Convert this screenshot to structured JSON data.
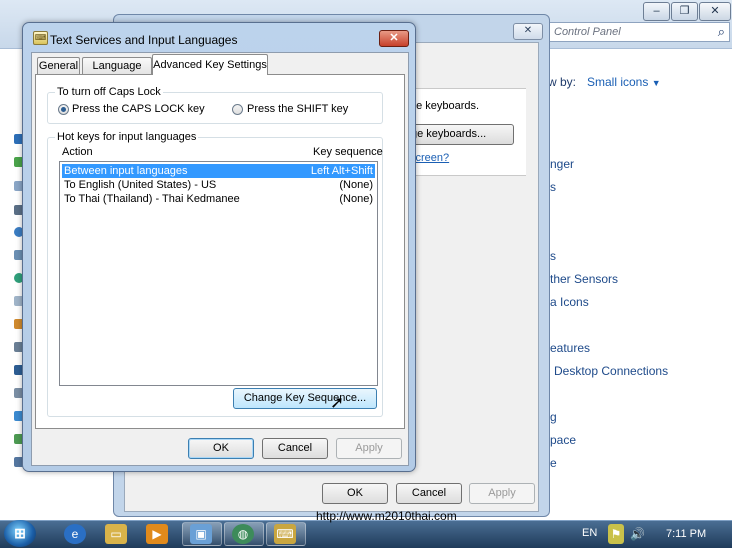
{
  "control_panel": {
    "search_placeholder": "Control Panel",
    "view_by_label": "w by:",
    "view_by_value": "Small icons",
    "items": [
      "nger",
      "s",
      "s",
      "ther Sensors",
      "a Icons",
      "eatures",
      "Desktop Connections",
      "g",
      "pace",
      "e"
    ],
    "window_buttons": [
      "–",
      "❐",
      "✕"
    ]
  },
  "region_dialog": {
    "close": "✕",
    "keyboards_text": "ge keyboards.",
    "keyboards_button": "ge keyboards...",
    "keyboards_link": "screen?",
    "ok": "OK",
    "cancel": "Cancel",
    "apply": "Apply"
  },
  "text_services": {
    "title": "Text Services and Input Languages",
    "close": "✕",
    "tabs": [
      "General",
      "Language Bar",
      "Advanced Key Settings"
    ],
    "caps_lock": {
      "group_label": "To turn off Caps Lock",
      "option1": "Press the CAPS LOCK key",
      "option2": "Press the SHIFT key",
      "selected": "option1"
    },
    "hotkeys": {
      "group_label": "Hot keys for input languages",
      "col_action": "Action",
      "col_key": "Key sequence",
      "rows": [
        {
          "action": "Between input languages",
          "key": "Left Alt+Shift"
        },
        {
          "action": "To English (United States) - US",
          "key": "(None)"
        },
        {
          "action": "To Thai (Thailand) - Thai Kedmanee",
          "key": "(None)"
        }
      ],
      "change_button": "Change Key Sequence..."
    },
    "ok": "OK",
    "cancel": "Cancel",
    "apply": "Apply"
  },
  "taskbar": {
    "lang": "EN",
    "time": "7:11 PM"
  },
  "watermark": "http://www.m2010thai.com"
}
